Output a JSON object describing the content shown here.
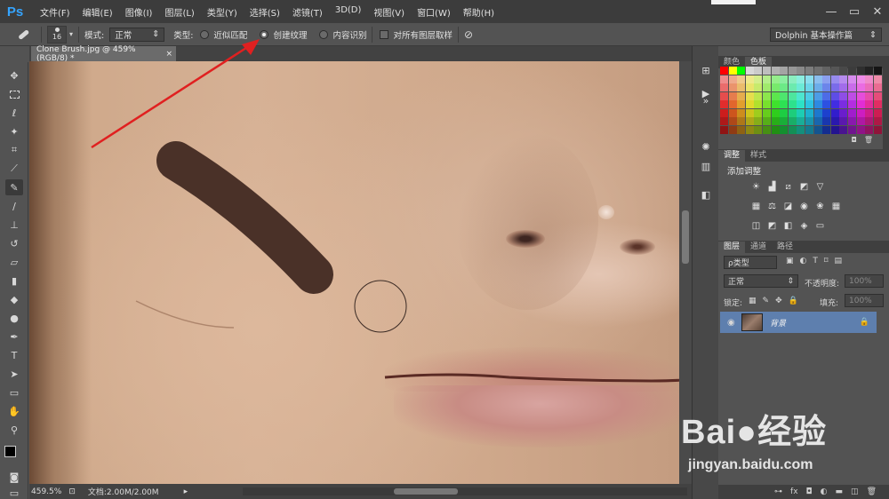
{
  "app": {
    "logo": "Ps"
  },
  "menu": [
    "文件(F)",
    "编辑(E)",
    "图像(I)",
    "图层(L)",
    "类型(Y)",
    "选择(S)",
    "滤镜(T)",
    "3D(D)",
    "视图(V)",
    "窗口(W)",
    "帮助(H)"
  ],
  "window_controls": [
    "—",
    "▭",
    "✕"
  ],
  "options": {
    "brush_size": "16",
    "mode_label": "模式:",
    "mode_value": "正常",
    "type_label": "类型:",
    "radio_proximity": "近似匹配",
    "radio_texture": "创建纹理",
    "radio_content": "内容识别",
    "sample_all": "对所有图层取样",
    "workspace": "Dolphin 基本操作篇"
  },
  "document": {
    "tab_title": "Clone Brush.jpg @ 459%(RGB/8) *",
    "close": "×"
  },
  "status": {
    "zoom": "459.5%",
    "doc_size": "文档:2.00M/2.00M"
  },
  "panels": {
    "swatch_tabs": [
      "颜色",
      "色板"
    ],
    "adjust_tabs": [
      "调整",
      "样式"
    ],
    "adjust_title": "添加调整",
    "layers_tabs": [
      "图层",
      "通道",
      "路径"
    ],
    "layer_filter": "ρ类型",
    "blend_mode": "正常",
    "opacity_label": "不透明度:",
    "opacity_value": "100%",
    "lock_label": "锁定:",
    "fill_label": "填充:",
    "fill_value": "100%",
    "layer_name": "背景"
  },
  "watermark": {
    "logo": "Bai●经验",
    "url": "jingyan.baidu.com"
  },
  "colors": {
    "accent": "#35a4ff",
    "layer_selected": "#5e7fae",
    "arrow": "#e02020",
    "brush_stroke": "#4a3128"
  }
}
